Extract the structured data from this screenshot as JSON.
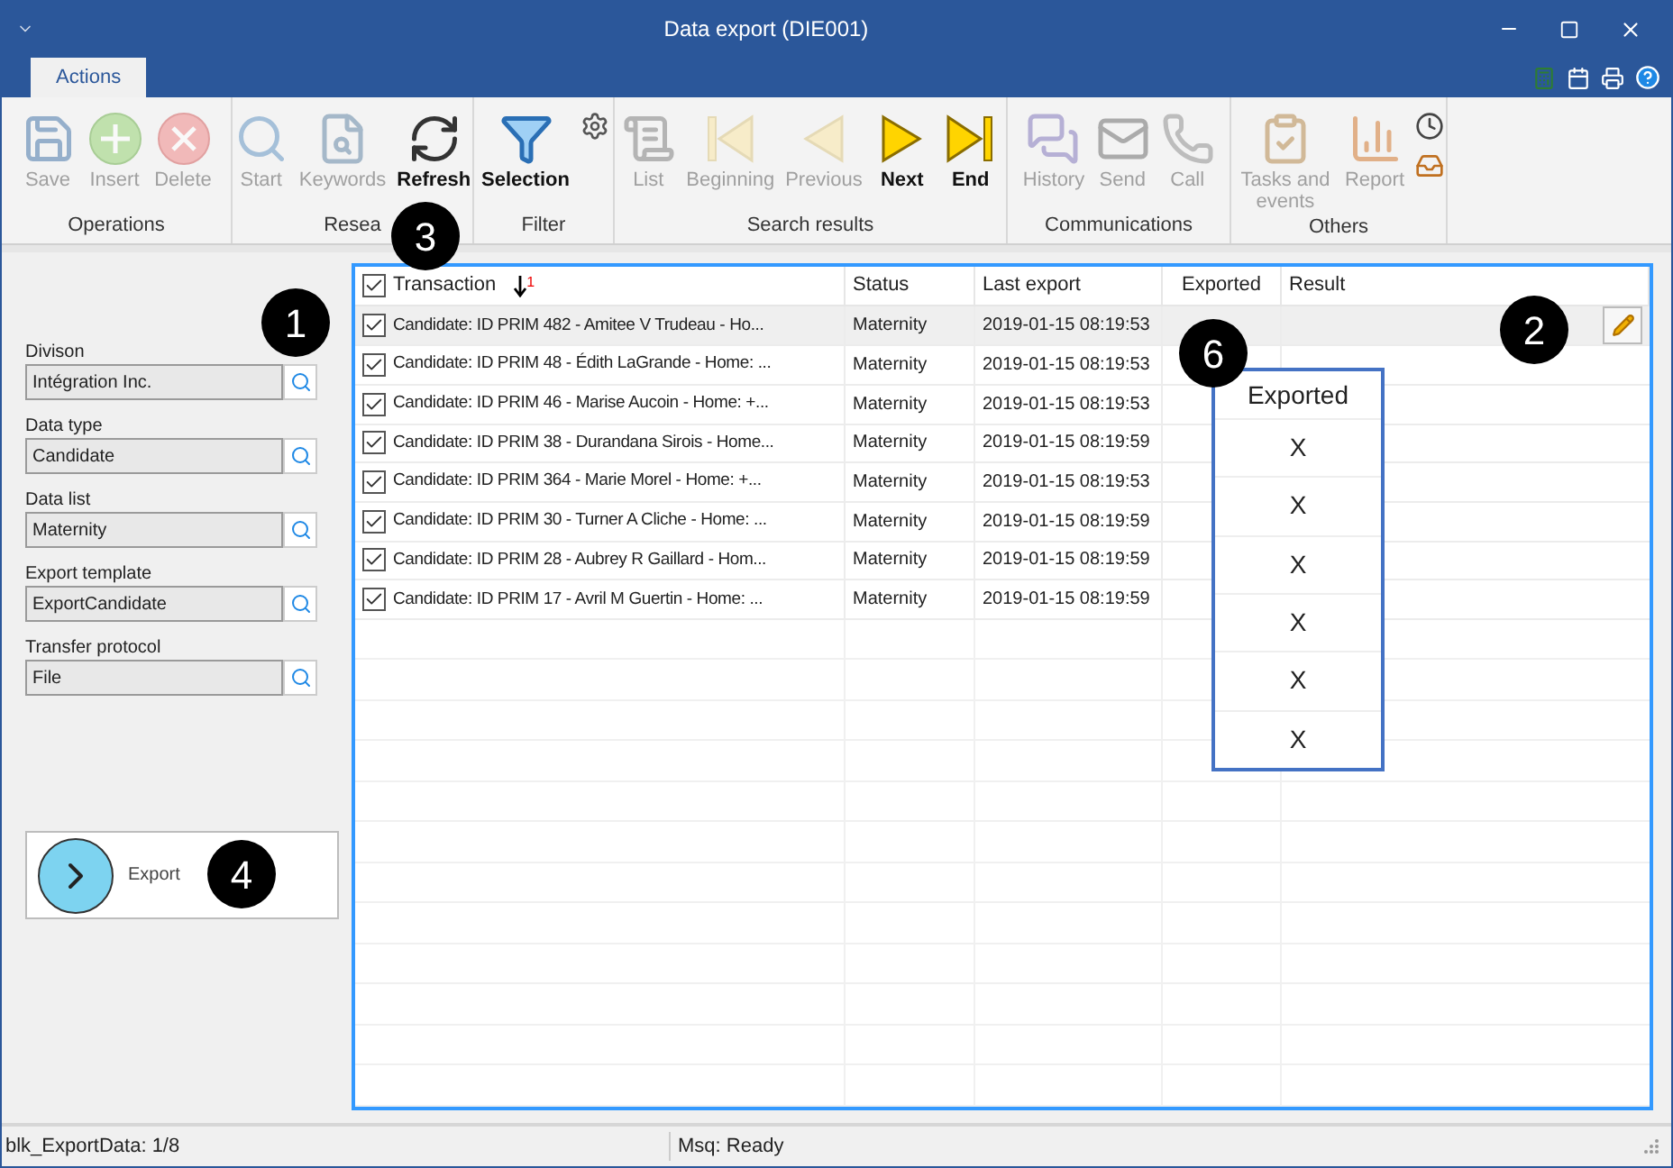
{
  "window": {
    "title": "Data export (DIE001)"
  },
  "tabs": [
    {
      "label": "Actions",
      "selected": true
    }
  ],
  "ribbon": {
    "groups": [
      {
        "label": "Operations",
        "buttons": [
          {
            "label": "Save",
            "kind": "save",
            "disabled": true
          },
          {
            "label": "Insert",
            "kind": "insert",
            "disabled": true
          },
          {
            "label": "Delete",
            "kind": "delete",
            "disabled": true
          }
        ]
      },
      {
        "label": "Resea",
        "buttons": [
          {
            "label": "Start",
            "kind": "start",
            "disabled": true
          },
          {
            "label": "Keywords",
            "kind": "keywords",
            "disabled": true
          },
          {
            "label": "Refresh",
            "kind": "refresh",
            "disabled": false
          }
        ]
      },
      {
        "label": "Filter",
        "buttons": [
          {
            "label": "Selection",
            "kind": "selection",
            "disabled": false
          }
        ],
        "extras": [
          {
            "kind": "settings",
            "disabled": false
          }
        ]
      },
      {
        "label": "Search results",
        "buttons": [
          {
            "label": "List",
            "kind": "list",
            "disabled": true
          },
          {
            "label": "Beginning",
            "kind": "beginning",
            "disabled": true
          },
          {
            "label": "Previous",
            "kind": "previous",
            "disabled": true
          },
          {
            "label": "Next",
            "kind": "next",
            "disabled": false
          },
          {
            "label": "End",
            "kind": "end",
            "disabled": false
          }
        ]
      },
      {
        "label": "Communications",
        "buttons": [
          {
            "label": "History",
            "kind": "history",
            "disabled": true
          },
          {
            "label": "Send",
            "kind": "send",
            "disabled": true
          },
          {
            "label": "Call",
            "kind": "call",
            "disabled": true
          }
        ]
      },
      {
        "label": "Others",
        "buttons": [
          {
            "label": "Tasks and events",
            "kind": "tasks",
            "disabled": true
          },
          {
            "label": "Report",
            "kind": "report",
            "disabled": true
          }
        ],
        "extras": [
          {
            "kind": "clock",
            "disabled": false
          },
          {
            "kind": "inbox",
            "disabled": false
          }
        ]
      }
    ]
  },
  "fields": [
    {
      "label": "Divison",
      "value": "Intégration Inc."
    },
    {
      "label": "Data type",
      "value": "Candidate"
    },
    {
      "label": "Data list",
      "value": "Maternity"
    },
    {
      "label": "Export template",
      "value": "ExportCandidate"
    },
    {
      "label": "Transfer protocol",
      "value": "File"
    }
  ],
  "export_button": {
    "label": "Export"
  },
  "table": {
    "all_checked": true,
    "columns": [
      {
        "label": "Transaction",
        "sort_badge": "1"
      },
      {
        "label": "Status"
      },
      {
        "label": "Last export"
      },
      {
        "label": "Exported"
      },
      {
        "label": "Result"
      }
    ],
    "rows": [
      {
        "checked": true,
        "selected": true,
        "transaction": "Candidate: ID PRIM 482 - Amitee V Trudeau - Ho...",
        "status": "Maternity",
        "last_export": "2019-01-15 08:19:53"
      },
      {
        "checked": true,
        "selected": false,
        "transaction": "Candidate: ID PRIM 48 - Édith LaGrande - Home: ...",
        "status": "Maternity",
        "last_export": "2019-01-15 08:19:53"
      },
      {
        "checked": true,
        "selected": false,
        "transaction": "Candidate: ID PRIM 46 - Marise Aucoin - Home: +...",
        "status": "Maternity",
        "last_export": "2019-01-15 08:19:53"
      },
      {
        "checked": true,
        "selected": false,
        "transaction": "Candidate: ID PRIM 38 - Durandana Sirois - Home...",
        "status": "Maternity",
        "last_export": "2019-01-15 08:19:59"
      },
      {
        "checked": true,
        "selected": false,
        "transaction": "Candidate: ID PRIM 364 - Marie Morel - Home: +...",
        "status": "Maternity",
        "last_export": "2019-01-15 08:19:53"
      },
      {
        "checked": true,
        "selected": false,
        "transaction": "Candidate: ID PRIM 30 - Turner A Cliche - Home: ...",
        "status": "Maternity",
        "last_export": "2019-01-15 08:19:59"
      },
      {
        "checked": true,
        "selected": false,
        "transaction": "Candidate: ID PRIM 28 - Aubrey R Gaillard - Hom...",
        "status": "Maternity",
        "last_export": "2019-01-15 08:19:59"
      },
      {
        "checked": true,
        "selected": false,
        "transaction": "Candidate: ID PRIM 17 - Avril M Guertin - Home: ...",
        "status": "Maternity",
        "last_export": "2019-01-15 08:19:59"
      }
    ]
  },
  "exported_callout": {
    "title": "Exported",
    "marks": [
      "X",
      "X",
      "X",
      "X",
      "X",
      "X"
    ]
  },
  "callouts": [
    {
      "label": "1"
    },
    {
      "label": "2"
    },
    {
      "label": "3"
    },
    {
      "label": "4"
    },
    {
      "label": "6"
    }
  ],
  "status_bar": [
    "blk_ExportData: 1/8",
    "Msq: Ready"
  ]
}
